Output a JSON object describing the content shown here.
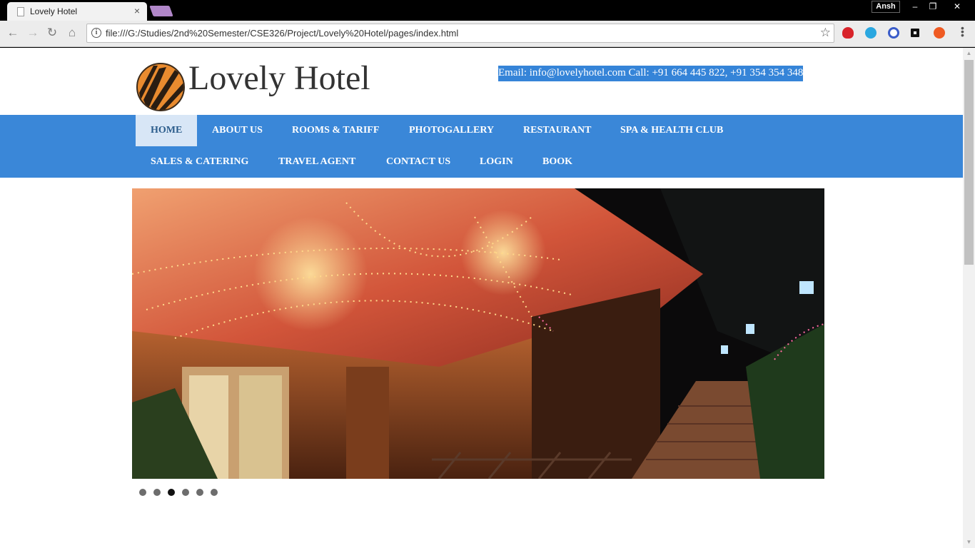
{
  "browser": {
    "tab_title": "Lovely Hotel",
    "tab_close": "×",
    "profile_name": "Ansh",
    "minimize": "–",
    "restore": "❐",
    "close": "✕",
    "url": "file:///G:/Studies/2nd%20Semester/CSE326/Project/Lovely%20Hotel/pages/index.html",
    "back": "←",
    "forward": "→",
    "reload": "↻",
    "home": "⌂",
    "star": "☆",
    "info": "i"
  },
  "header": {
    "site_title": "Lovely Hotel",
    "contact": "Email: info@lovelyhotel.com   Call: +91 664 445 822, +91 354 354 348"
  },
  "nav": {
    "items": [
      {
        "label": "HOME"
      },
      {
        "label": "ABOUT US"
      },
      {
        "label": "ROOMS & TARIFF"
      },
      {
        "label": "PHOTOGALLERY"
      },
      {
        "label": "RESTAURANT"
      },
      {
        "label": "SPA & HEALTH CLUB"
      },
      {
        "label": "SALES & CATERING"
      },
      {
        "label": "TRAVEL AGENT"
      },
      {
        "label": "CONTACT US"
      },
      {
        "label": "LOGIN"
      },
      {
        "label": "BOOK"
      }
    ],
    "active_index": 0
  },
  "slider": {
    "slide_count": 6,
    "active_slide": 3
  },
  "colors": {
    "nav_bar": "#3a87d8",
    "nav_active_bg": "#d8e6f6",
    "contact_highlight": "#3584d8",
    "logo_orange": "#e98b2f"
  }
}
